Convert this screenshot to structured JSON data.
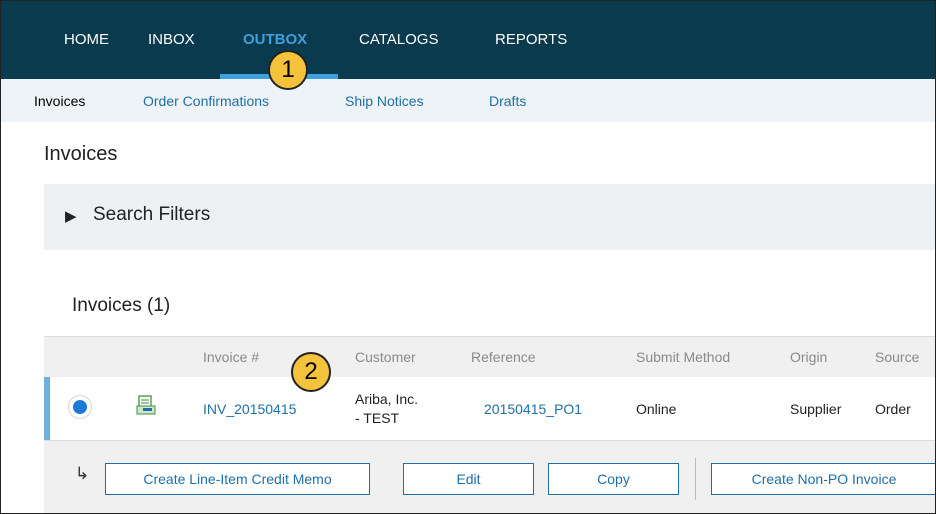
{
  "topnav": {
    "items": [
      {
        "label": "HOME"
      },
      {
        "label": "INBOX"
      },
      {
        "label": "OUTBOX"
      },
      {
        "label": "CATALOGS"
      },
      {
        "label": "REPORTS"
      }
    ],
    "active": "OUTBOX"
  },
  "subnav": {
    "tabs": [
      {
        "label": "Invoices"
      },
      {
        "label": "Order Confirmations"
      },
      {
        "label": "Ship Notices"
      },
      {
        "label": "Drafts"
      }
    ],
    "active": "Invoices"
  },
  "page": {
    "title": "Invoices",
    "filters_label": "Search Filters",
    "section_title": "Invoices (1)"
  },
  "table": {
    "headers": [
      "Invoice #",
      "Customer",
      "Reference",
      "Submit Method",
      "Origin",
      "Source"
    ],
    "rows": [
      {
        "invoice": "INV_20150415",
        "customer_line1": "Ariba, Inc.",
        "customer_line2": "- TEST",
        "reference": "20150415_PO1",
        "submit_method": "Online",
        "origin": "Supplier",
        "source": "Order"
      }
    ]
  },
  "actions": {
    "return_icon": "return-arrow-icon",
    "buttons": [
      "Create Line-Item Credit Memo",
      "Edit",
      "Copy",
      "Create Non-PO Invoice"
    ]
  },
  "callouts": [
    "1",
    "2"
  ],
  "colors": {
    "nav_bg": "#0a3a4e",
    "accent": "#3d9fdc",
    "link": "#1f6fa6",
    "callout": "#f5c33b"
  }
}
